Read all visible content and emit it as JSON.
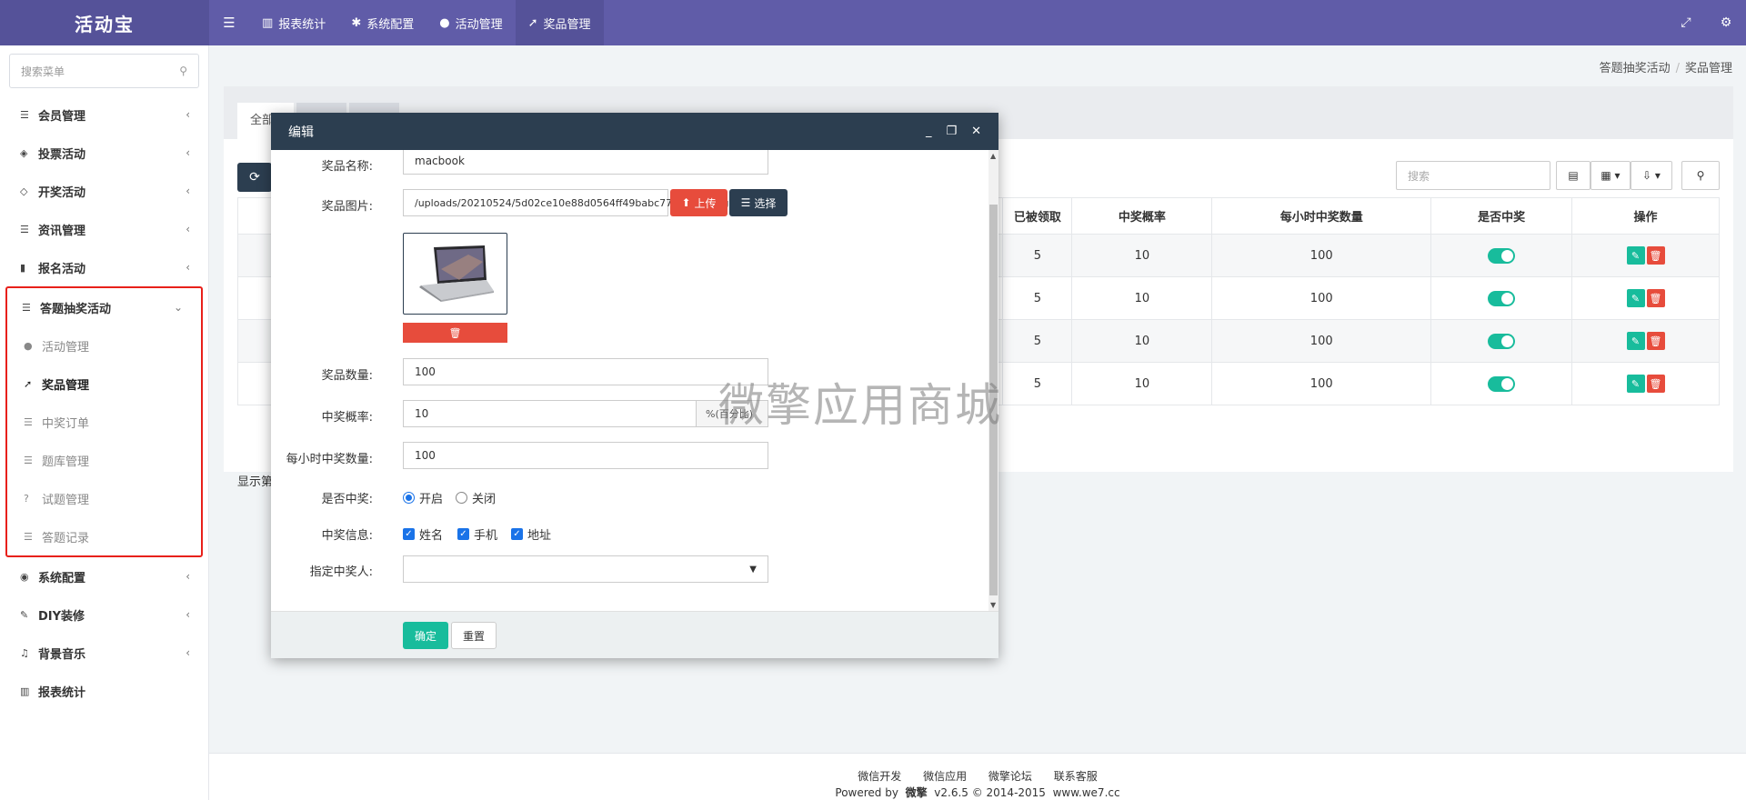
{
  "app": {
    "brand": "活动宝"
  },
  "topnav": {
    "items": [
      {
        "label": "报表统计",
        "icon": "bar-chart-icon"
      },
      {
        "label": "系统配置",
        "icon": "gear-icon"
      },
      {
        "label": "活动管理",
        "icon": "circle-icon"
      },
      {
        "label": "奖品管理",
        "icon": "rocket-icon",
        "active": true
      }
    ]
  },
  "sidebar": {
    "search_placeholder": "搜索菜单",
    "items_top": [
      {
        "label": "会员管理",
        "icon": "list-icon"
      },
      {
        "label": "投票活动",
        "icon": "tag-icon"
      },
      {
        "label": "开奖活动",
        "icon": "diamond-icon"
      },
      {
        "label": "资讯管理",
        "icon": "list-icon"
      },
      {
        "label": "报名活动",
        "icon": "book-icon"
      }
    ],
    "group": {
      "label": "答题抽奖活动",
      "children": [
        {
          "label": "活动管理",
          "icon": "circle-icon"
        },
        {
          "label": "奖品管理",
          "icon": "rocket-icon",
          "current": true
        },
        {
          "label": "中奖订单",
          "icon": "list-icon"
        },
        {
          "label": "题库管理",
          "icon": "list-icon"
        },
        {
          "label": "试题管理",
          "icon": "question-icon"
        },
        {
          "label": "答题记录",
          "icon": "list-icon"
        }
      ]
    },
    "items_bottom": [
      {
        "label": "系统配置",
        "icon": "compass-icon"
      },
      {
        "label": "DIY装修",
        "icon": "magic-icon"
      },
      {
        "label": "背景音乐",
        "icon": "music-icon"
      },
      {
        "label": "报表统计",
        "icon": "bar-chart-icon"
      }
    ]
  },
  "breadcrumb": {
    "parent": "答题抽奖活动",
    "current": "奖品管理"
  },
  "panel": {
    "tab_label": "全部",
    "search_placeholder": "搜索",
    "showing_text": "显示第",
    "columns": [
      "已被领取",
      "中奖概率",
      "每小时中奖数量",
      "是否中奖",
      "操作"
    ],
    "rows": [
      {
        "claimed": "5",
        "rate": "10",
        "hourly": "100",
        "win": true
      },
      {
        "claimed": "5",
        "rate": "10",
        "hourly": "100",
        "win": true
      },
      {
        "claimed": "5",
        "rate": "10",
        "hourly": "100",
        "win": true
      },
      {
        "claimed": "5",
        "rate": "10",
        "hourly": "100",
        "win": true
      }
    ]
  },
  "modal": {
    "title": "编辑",
    "fields": {
      "name_label": "奖品名称:",
      "name_value": "macbook",
      "image_label": "奖品图片:",
      "image_value": "/uploads/20210524/5d02ce10e88d0564ff49babc7715ed52.jpg",
      "upload_label": "上传",
      "select_label": "选择",
      "qty_label": "奖品数量:",
      "qty_value": "100",
      "rate_label": "中奖概率:",
      "rate_value": "10",
      "rate_suffix": "%(百分比)",
      "hourly_label": "每小时中奖数量:",
      "hourly_value": "100",
      "win_label": "是否中奖:",
      "win_on": "开启",
      "win_off": "关闭",
      "info_label": "中奖信息:",
      "info_name": "姓名",
      "info_phone": "手机",
      "info_addr": "地址",
      "winner_label": "指定中奖人:"
    },
    "confirm_label": "确定",
    "reset_label": "重置"
  },
  "watermark": "微擎应用商城",
  "footer": {
    "links": [
      "微信开发",
      "微信应用",
      "微擎论坛",
      "联系客服"
    ],
    "powered": "Powered by",
    "brand": "微擎",
    "version": "v2.6.5 © 2014-2015",
    "site": "www.we7.cc"
  }
}
